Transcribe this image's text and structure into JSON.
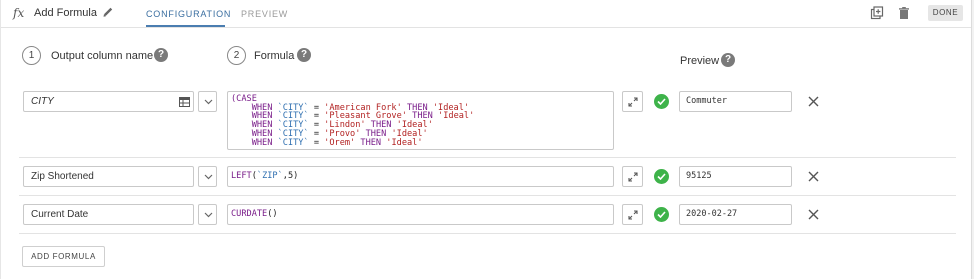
{
  "header": {
    "fx_symbol": "fx",
    "title": "Add Formula",
    "tabs": [
      {
        "label": "CONFIGURATION",
        "active": true
      },
      {
        "label": "PREVIEW",
        "active": false
      }
    ],
    "done_label": "DONE"
  },
  "steps": [
    {
      "number": "1",
      "label": "Output column name"
    },
    {
      "number": "2",
      "label": "Formula"
    }
  ],
  "preview_header": "Preview",
  "help_glyph": "?",
  "rows": [
    {
      "name": "CITY",
      "formula_lines": [
        "(CASE",
        "    WHEN `CITY` = 'American Fork' THEN 'Ideal'",
        "    WHEN `CITY` = 'Pleasant Grove' THEN 'Ideal'",
        "    WHEN `CITY` = 'Lindon' THEN 'Ideal'",
        "    WHEN `CITY` = 'Provo' THEN 'Ideal'",
        "    WHEN `CITY` = 'Orem' THEN 'Ideal'"
      ],
      "preview": "Commuter",
      "valid": true
    },
    {
      "name": "Zip Shortened",
      "formula_lines": [
        "LEFT(`ZIP`,5)"
      ],
      "preview": "95125",
      "valid": true
    },
    {
      "name": "Current Date",
      "formula_lines": [
        "CURDATE()"
      ],
      "preview": "2020-02-27",
      "valid": true
    }
  ],
  "add_formula_label": "ADD FORMULA",
  "colors": {
    "accent": "#3a6ea0",
    "success": "#3eb34a",
    "keyword": "#7a1e8a",
    "string": "#b22222",
    "column": "#2f6fb0"
  },
  "icons": [
    "fx-icon",
    "pencil-icon",
    "duplicate-icon",
    "trash-icon",
    "help-icon",
    "table-icon",
    "chevron-down-icon",
    "expand-icon",
    "check-circle-icon",
    "close-icon"
  ]
}
